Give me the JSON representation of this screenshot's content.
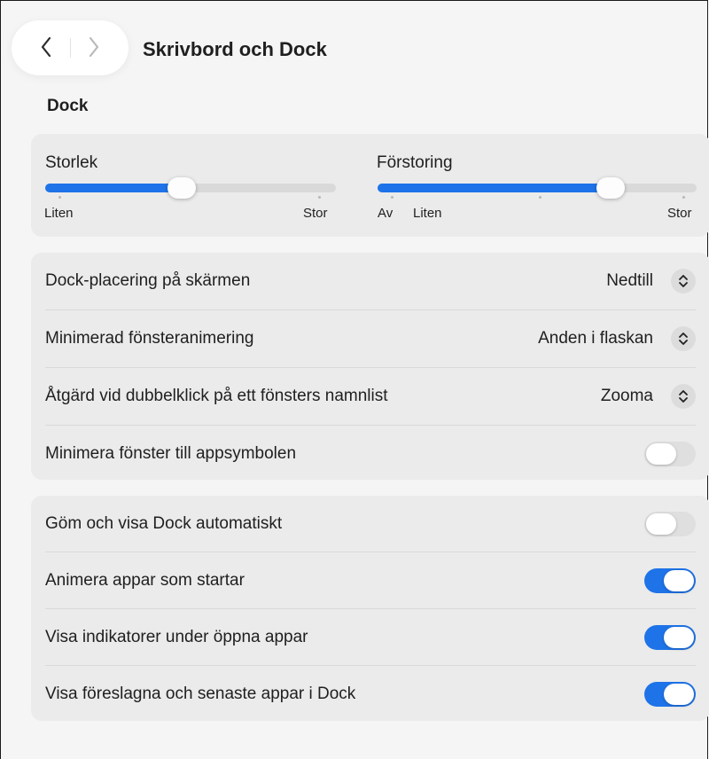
{
  "header": {
    "title": "Skrivbord och Dock",
    "back_icon": "chevron-left-icon",
    "forward_icon": "chevron-right-icon"
  },
  "section": {
    "title": "Dock"
  },
  "sliders": {
    "size": {
      "label": "Storlek",
      "min_label": "Liten",
      "max_label": "Stor",
      "value_fraction": 0.47
    },
    "magnification": {
      "label": "Förstoring",
      "off_label": "Av",
      "min_label": "Liten",
      "max_label": "Stor",
      "value_fraction": 0.73
    }
  },
  "placement_rows": [
    {
      "label": "Dock-placering på skärmen",
      "value": "Nedtill"
    },
    {
      "label": "Minimerad fönsteranimering",
      "value": "Anden i flaskan"
    },
    {
      "label": "Åtgärd vid dubbelklick på ett fönsters namnlist",
      "value": "Zooma"
    },
    {
      "label": "Minimera fönster till appsymbolen",
      "toggle": false
    }
  ],
  "toggle_rows": [
    {
      "label": "Göm och visa Dock automatiskt",
      "toggle": false
    },
    {
      "label": "Animera appar som startar",
      "toggle": true
    },
    {
      "label": "Visa indikatorer under öppna appar",
      "toggle": true
    },
    {
      "label": "Visa föreslagna och senaste appar i Dock",
      "toggle": true
    }
  ],
  "colors": {
    "accent": "#1e73e8",
    "card": "#ebebeb",
    "background": "#f5f5f5"
  }
}
